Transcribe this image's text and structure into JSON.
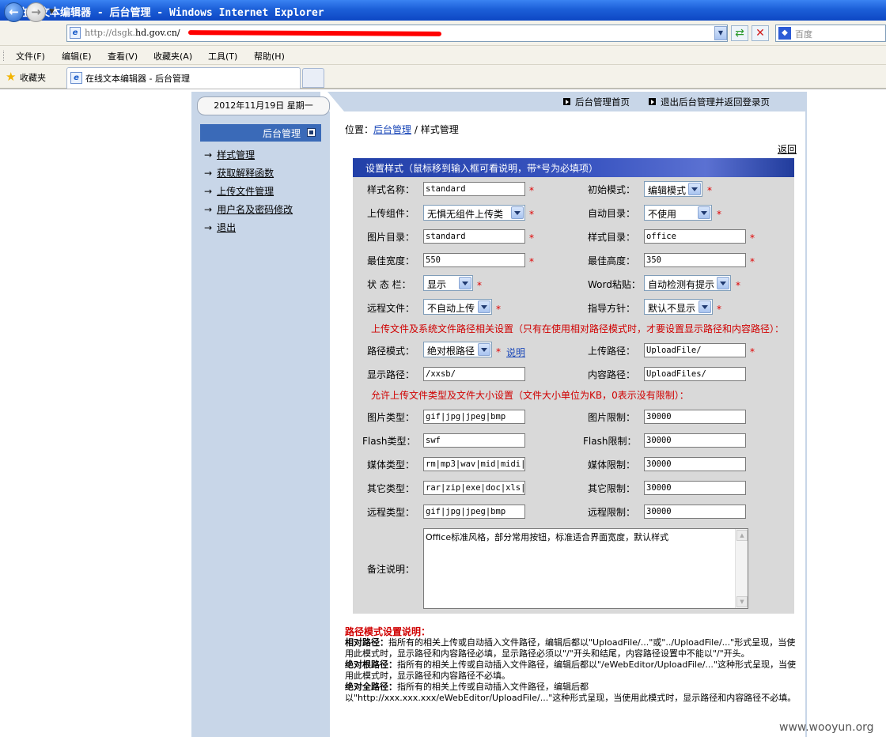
{
  "window": {
    "title": "在线文本编辑器 - 后台管理 - Windows Internet Explorer"
  },
  "browser": {
    "url_host": "http://dsgk.",
    "url_rest": "hd.gov.cn/",
    "search_placeholder": "百度",
    "menu": [
      "文件(F)",
      "编辑(E)",
      "查看(V)",
      "收藏夹(A)",
      "工具(T)",
      "帮助(H)"
    ],
    "favorites_label": "收藏夹",
    "tab_title": "在线文本编辑器 - 后台管理"
  },
  "header": {
    "date": "2012年11月19日 星期一",
    "home_link": "后台管理首页",
    "logout_link": "退出后台管理并返回登录页"
  },
  "sidebar": {
    "title": "后台管理",
    "items": [
      "样式管理",
      "获取解释函数",
      "上传文件管理",
      "用户名及密码修改",
      "退出"
    ]
  },
  "breadcrumb": {
    "prefix": "位置：",
    "link": "后台管理",
    "sep": " / ",
    "current": "样式管理"
  },
  "back_label": "返回",
  "form": {
    "heading": "设置样式（鼠标移到输入框可看说明，带*号为必填项）",
    "required_mark": "*",
    "style_name": {
      "label": "样式名称：",
      "value": "standard"
    },
    "init_mode": {
      "label": "初始模式：",
      "value": "编辑模式"
    },
    "upload_component": {
      "label": "上传组件：",
      "value": "无惧无组件上传类"
    },
    "auto_dir": {
      "label": "自动目录：",
      "value": "不使用"
    },
    "image_dir": {
      "label": "图片目录：",
      "value": "standard"
    },
    "style_dir": {
      "label": "样式目录：",
      "value": "office"
    },
    "best_width": {
      "label": "最佳宽度：",
      "value": "550"
    },
    "best_height": {
      "label": "最佳高度：",
      "value": "350"
    },
    "status_bar": {
      "label": "状 态 栏：",
      "value": "显示"
    },
    "word_paste": {
      "label": "Word粘贴：",
      "value": "自动检测有提示"
    },
    "remote_file": {
      "label": "远程文件：",
      "value": "不自动上传"
    },
    "guide": {
      "label": "指导方针：",
      "value": "默认不显示"
    },
    "section_paths": "上传文件及系统文件路径相关设置（只有在使用相对路径模式时，才要设置显示路径和内容路径）：",
    "path_mode": {
      "label": "路径模式：",
      "value": "绝对根路径",
      "help": "说明"
    },
    "upload_path": {
      "label": "上传路径：",
      "value": "UploadFile/"
    },
    "display_path": {
      "label": "显示路径：",
      "value": "/xxsb/"
    },
    "content_path": {
      "label": "内容路径：",
      "value": "UploadFiles/"
    },
    "section_types": "允许上传文件类型及文件大小设置（文件大小单位为KB，0表示没有限制）：",
    "image_types": {
      "label": "图片类型：",
      "value": "gif|jpg|jpeg|bmp"
    },
    "image_limit": {
      "label": "图片限制：",
      "value": "30000"
    },
    "flash_types": {
      "label": "Flash类型：",
      "value": "swf"
    },
    "flash_limit": {
      "label": "Flash限制：",
      "value": "30000"
    },
    "media_types": {
      "label": "媒体类型：",
      "value": "rm|mp3|wav|mid|midi|r"
    },
    "media_limit": {
      "label": "媒体限制：",
      "value": "30000"
    },
    "other_types": {
      "label": "其它类型：",
      "value": "rar|zip|exe|doc|xls|c"
    },
    "other_limit": {
      "label": "其它限制：",
      "value": "30000"
    },
    "remote_types": {
      "label": "远程类型：",
      "value": "gif|jpg|jpeg|bmp"
    },
    "remote_limit": {
      "label": "远程限制：",
      "value": "30000"
    },
    "remark": {
      "label": "备注说明：",
      "value": "Office标准风格，部分常用按钮，标准适合界面宽度，默认样式"
    }
  },
  "notes": {
    "title": "路径模式设置说明：",
    "rel_label": "相对路径：",
    "rel_text": "指所有的相关上传或自动插入文件路径，编辑后都以\"UploadFile/...\"或\"../UploadFile/...\"形式呈现，当使用此模式时，显示路径和内容路径必填，显示路径必须以\"/\"开头和结尾，内容路径设置中不能以\"/\"开头。",
    "absroot_label": "绝对根路径：",
    "absroot_text": "指所有的相关上传或自动插入文件路径，编辑后都以\"/eWebEditor/UploadFile/...\"这种形式呈现，当使用此模式时，显示路径和内容路径不必填。",
    "absfull_label": "绝对全路径：",
    "absfull_text": "指所有的相关上传或自动插入文件路径，编辑后都以\"http://xxx.xxx.xxx/eWebEditor/UploadFile/...\"这种形式呈现，当使用此模式时，显示路径和内容路径不必填。"
  },
  "watermark": "www.wooyun.org",
  "colors": {
    "title_bar": "#1c5fd8",
    "sidebar_bg": "#c8d6e8",
    "form_header": "#2240a8",
    "required": "#e00000"
  }
}
